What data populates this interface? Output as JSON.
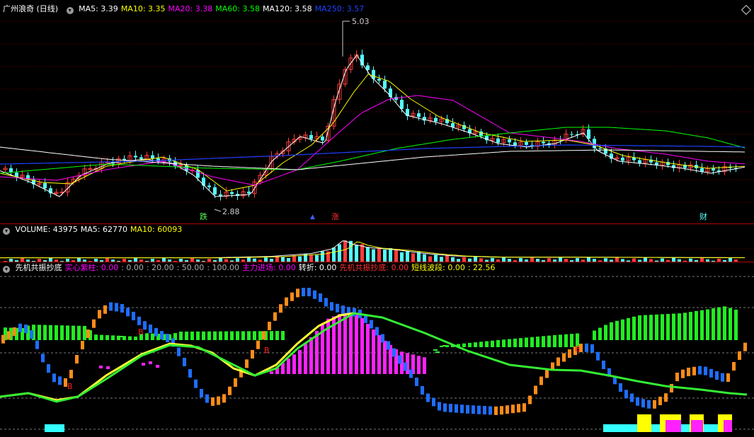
{
  "price_panel": {
    "title": "广州浪奇 (日线)",
    "ma": [
      {
        "label": "MA5: 3.39",
        "color": "#ffffff"
      },
      {
        "label": "MA10: 3.35",
        "color": "#ffff00"
      },
      {
        "label": "MA20: 3.38",
        "color": "#ff00ff"
      },
      {
        "label": "MA60: 3.58",
        "color": "#00ff00"
      },
      {
        "label": "MA120: 3.58",
        "color": "#ffffff"
      },
      {
        "label": "MA250: 3.57",
        "color": "#2040ff"
      }
    ],
    "high_label": "5.03",
    "low_label": "2.88",
    "markers": {
      "down": "跌",
      "up": "涨",
      "finance": "财"
    }
  },
  "volume_panel": {
    "items": [
      {
        "label": "VOLUME: 43975",
        "color": "#ffffff"
      },
      {
        "label": "MA5: 62770",
        "color": "#ffffff"
      },
      {
        "label": "MA10: 60093",
        "color": "#ffff00"
      }
    ]
  },
  "indicator_panel": {
    "items": [
      {
        "label": "先机共振抄底",
        "color": "#ffffff"
      },
      {
        "label": "实心紫柱: 0.00",
        "color": "#ff00ff"
      },
      {
        "label": ": 0.00",
        "color": "#aaaaaa"
      },
      {
        "label": ": 20.00",
        "color": "#aaaaaa"
      },
      {
        "label": ": 50.00",
        "color": "#aaaaaa"
      },
      {
        "label": ": 100.00",
        "color": "#aaaaaa"
      },
      {
        "label": "主力进场: 0.00",
        "color": "#ff00ff"
      },
      {
        "label": "转折: 0.00",
        "color": "#ffffff"
      },
      {
        "label": "先机共振抄底: 0.00",
        "color": "#ff3030"
      },
      {
        "label": "短线波段: 0.00",
        "color": "#ffff00"
      },
      {
        "label": ": 22.56",
        "color": "#ffff00"
      }
    ],
    "b_label": "B"
  },
  "chart_data": {
    "type": "candlestick",
    "price_ylim": [
      2.7,
      5.15
    ],
    "high": 5.03,
    "low": 2.88,
    "candle_count": 130,
    "indicator_levels": [
      0,
      20,
      50,
      100
    ],
    "colors": {
      "up": "#ff3c3c",
      "down": "#54ffff",
      "ma5": "#ffffff",
      "ma10": "#ffff00",
      "ma20": "#ff00ff",
      "ma60": "#00ff00",
      "ma120": "#ffffff",
      "ma250": "#2040ff",
      "bar_green": "#22ee22",
      "bar_magenta": "#ff22ff",
      "orange": "#ff8c1a",
      "blue": "#1e6eff"
    }
  }
}
